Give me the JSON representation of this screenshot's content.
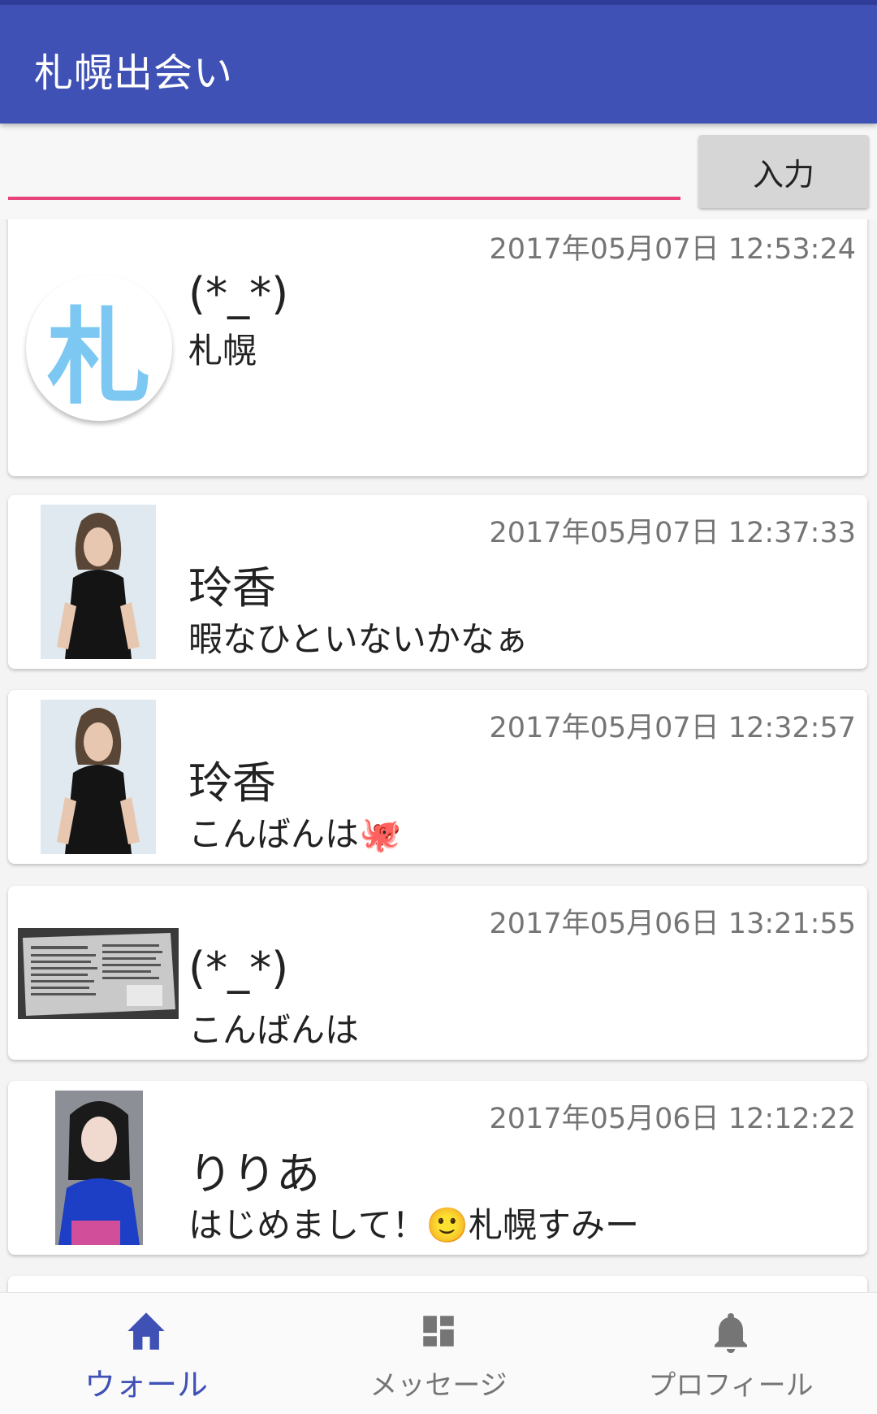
{
  "app": {
    "title": "札幌出会い"
  },
  "composer": {
    "input_value": "",
    "submit_label": "入力"
  },
  "posts": [
    {
      "name": "(*_*)",
      "message": "札幌",
      "timestamp": "2017年05月07日 12:53:24",
      "avatar": "logo",
      "avatar_text": "札"
    },
    {
      "name": "玲香",
      "message": "暇なひといないかなぁ",
      "timestamp": "2017年05月07日 12:37:33",
      "avatar": "photo-woman-black-dress"
    },
    {
      "name": "玲香",
      "message": "こんばんは🐙",
      "timestamp": "2017年05月07日 12:32:57",
      "avatar": "photo-woman-black-dress"
    },
    {
      "name": "(*_*)",
      "message": "こんばんは",
      "timestamp": "2017年05月06日 13:21:55",
      "avatar": "photo-newspaper"
    },
    {
      "name": "りりあ",
      "message": "はじめまして！🙂札幌すみー",
      "timestamp": "2017年05月06日 12:12:22",
      "avatar": "photo-woman-blue-top"
    }
  ],
  "bottom_nav": [
    {
      "label": "ウォール",
      "icon": "home-icon",
      "active": true
    },
    {
      "label": "メッセージ",
      "icon": "dashboard-icon",
      "active": false
    },
    {
      "label": "プロフィール",
      "icon": "bell-icon",
      "active": false
    }
  ],
  "colors": {
    "primary": "#3f51b5",
    "accent": "#e8447a",
    "timestamp": "#757575"
  }
}
